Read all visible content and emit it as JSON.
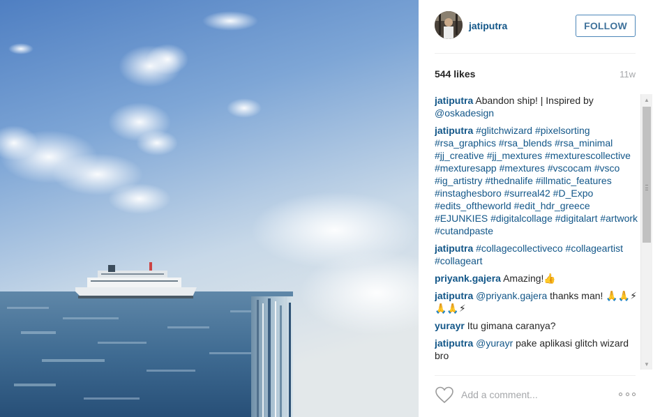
{
  "post": {
    "author": "jatiputra",
    "follow_label": "FOLLOW",
    "likes": "544 likes",
    "age": "11w"
  },
  "comments": [
    {
      "user": "jatiputra",
      "text": "Abandon ship! | Inspired by",
      "mention": "@oskadesign"
    },
    {
      "user": "jatiputra",
      "tags": "#glitchwizard #pixelsorting #rsa_graphics #rsa_blends #rsa_minimal #jj_creative #jj_mextures #mexturescollective #mexturesapp #mextures #vscocam #vsco #ig_artistry #thednalife #illmatic_features #instaghesboro #surreal42 #D_Expo #edits_oftheworld #edit_hdr_greece #EJUNKIES #digitalcollage #digitalart #artwork #cutandpaste"
    },
    {
      "user": "jatiputra",
      "tags": "#collagecollectiveco #collageartist #collageart"
    },
    {
      "user": "priyank.gajera",
      "text": "Amazing!👍"
    },
    {
      "user": "jatiputra",
      "mention": "@priyank.gajera",
      "text": "thanks man! 🙏🙏⚡🙏🙏⚡"
    },
    {
      "user": "yurayr",
      "text": "Itu gimana caranya?"
    },
    {
      "user": "jatiputra",
      "mention": "@yurayr",
      "text": "pake aplikasi glitch wizard bro"
    }
  ],
  "footer": {
    "comment_placeholder": "Add a comment..."
  },
  "icons": {
    "like": "heart-outline-icon",
    "more": "more-options-icon"
  },
  "colors": {
    "link_blue": "#125688",
    "follow_blue": "#3f729b",
    "muted_gray": "#a5a7aa"
  }
}
